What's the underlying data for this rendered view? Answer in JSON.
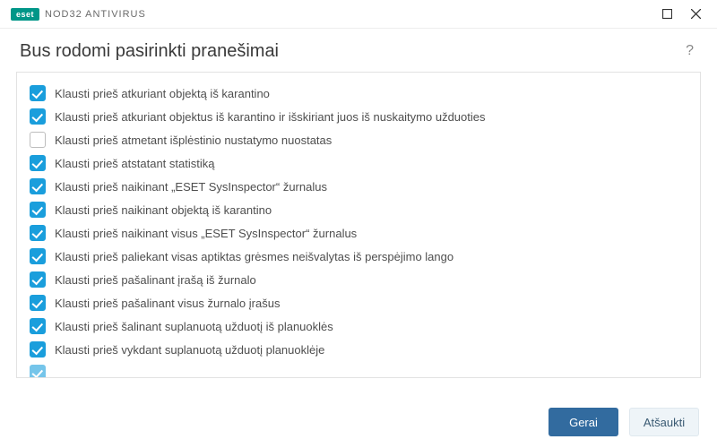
{
  "brand": {
    "badge": "eset",
    "product": "NOD32 ANTIVIRUS"
  },
  "page_title": "Bus rodomi pasirinkti pranešimai",
  "items": [
    {
      "checked": true,
      "label": "Klausti prieš atkuriant objektą iš karantino"
    },
    {
      "checked": true,
      "label": "Klausti prieš atkuriant objektus iš karantino ir išskiriant juos iš nuskaitymo užduoties"
    },
    {
      "checked": false,
      "label": "Klausti prieš atmetant išplėstinio nustatymo nuostatas"
    },
    {
      "checked": true,
      "label": "Klausti prieš atstatant statistiką"
    },
    {
      "checked": true,
      "label": "Klausti prieš naikinant „ESET SysInspector“ žurnalus"
    },
    {
      "checked": true,
      "label": "Klausti prieš naikinant objektą iš karantino"
    },
    {
      "checked": true,
      "label": "Klausti prieš naikinant visus „ESET SysInspector“ žurnalus"
    },
    {
      "checked": true,
      "label": "Klausti prieš paliekant visas aptiktas grėsmes neišvalytas iš perspėjimo lango"
    },
    {
      "checked": true,
      "label": "Klausti prieš pašalinant įrašą iš žurnalo"
    },
    {
      "checked": true,
      "label": "Klausti prieš pašalinant visus žurnalo įrašus"
    },
    {
      "checked": true,
      "label": "Klausti prieš šalinant suplanuotą užduotį iš planuoklės"
    },
    {
      "checked": true,
      "label": "Klausti prieš vykdant suplanuotą užduotį planuoklėje"
    }
  ],
  "buttons": {
    "ok": "Gerai",
    "cancel": "Atšaukti"
  },
  "help_symbol": "?"
}
